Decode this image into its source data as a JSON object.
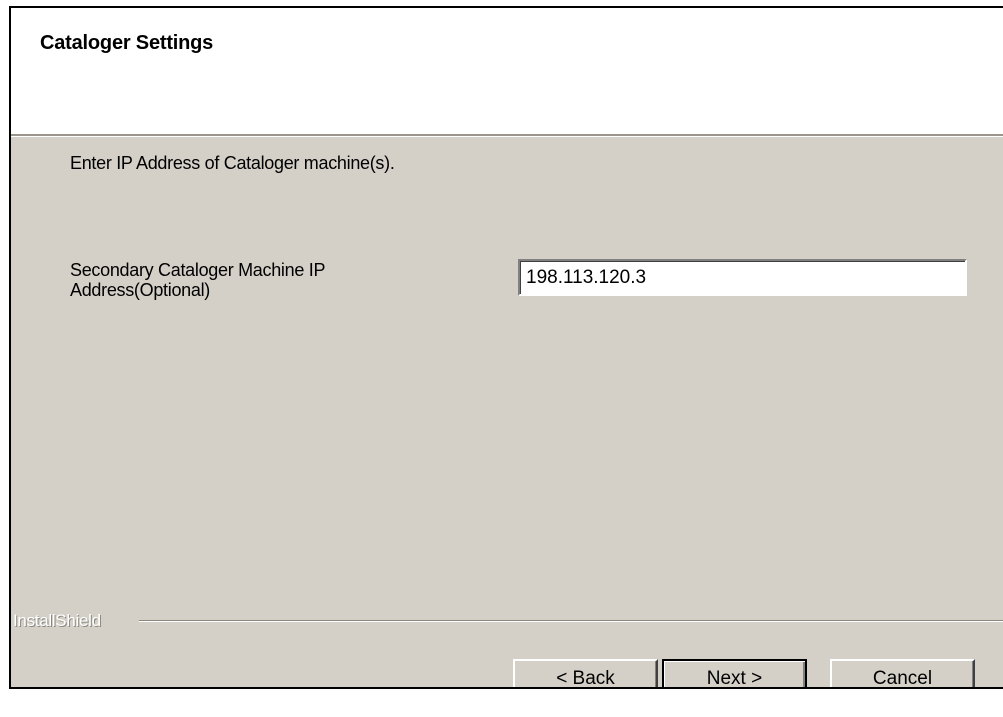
{
  "header": {
    "title": "Cataloger Settings"
  },
  "content": {
    "instruction": "Enter IP Address of Cataloger machine(s).",
    "secondary_ip": {
      "label": "Secondary Cataloger Machine IP Address(Optional)",
      "value": "198.113.120.3"
    }
  },
  "footer": {
    "brand": "InstallShield",
    "buttons": {
      "back": "< Back",
      "next": "Next >",
      "cancel": "Cancel"
    }
  },
  "colors": {
    "dialog_background": "#d4d0c8",
    "header_background": "#ffffff"
  }
}
